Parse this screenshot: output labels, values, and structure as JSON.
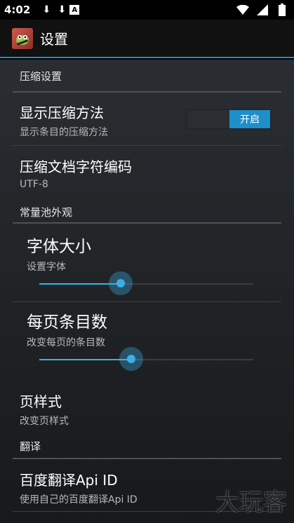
{
  "status_bar": {
    "time": "4:02",
    "icons": [
      "download-icon",
      "download-icon",
      "font-icon",
      "wifi-icon",
      "signal-icon",
      "battery-icon"
    ]
  },
  "action_bar": {
    "title": "设置",
    "app_icon": "app-icon"
  },
  "sections": {
    "compress": {
      "header": "压缩设置"
    },
    "appearance": {
      "header": "常量池外观"
    },
    "translate": {
      "header": "翻译"
    }
  },
  "prefs": {
    "show_compress": {
      "title": "显示压缩方法",
      "summary": "显示条目的压缩方法",
      "switch_label": "开启",
      "value": true
    },
    "archive_charset": {
      "title": "压缩文档字符编码",
      "summary": "UTF-8"
    },
    "font_size": {
      "title": "字体大小",
      "summary": "设置字体",
      "level": 0.38
    },
    "items_per_page": {
      "title": "每页条目数",
      "summary": "改变每页的条目数",
      "level": 0.43
    },
    "page_style": {
      "title": "页样式",
      "summary": "改变页样式"
    },
    "baidu_api_id": {
      "title": "百度翻译Api ID",
      "summary": "使用自己的百度翻译Api ID"
    }
  },
  "watermark": "大玩客",
  "colors": {
    "accent": "#1e8fc8",
    "slider": "#3bb0e8"
  }
}
